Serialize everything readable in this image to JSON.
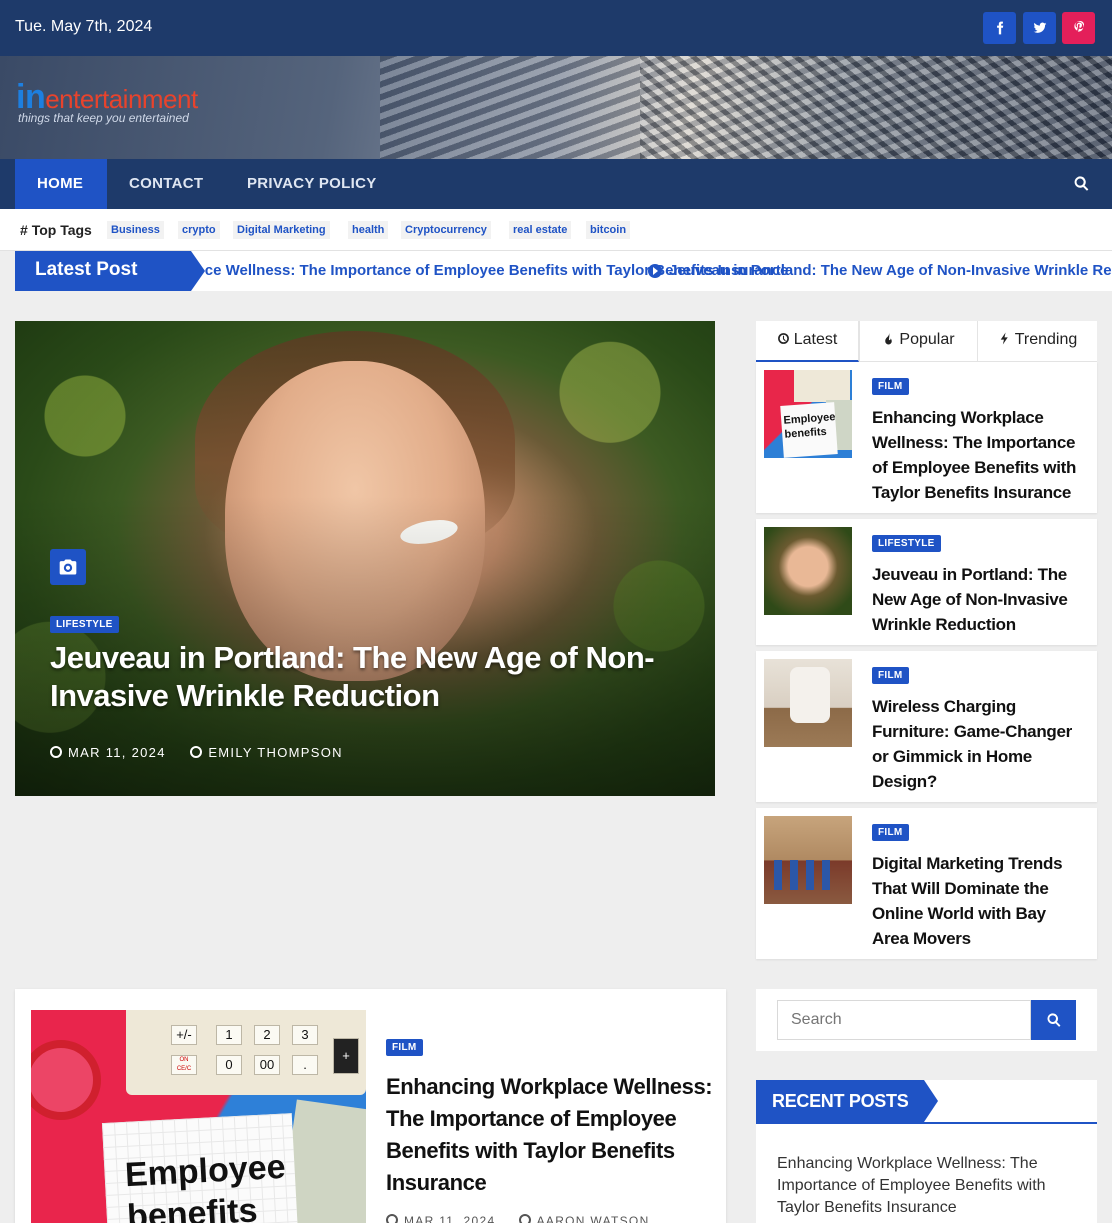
{
  "topbar": {
    "date": "Tue. May 7th, 2024",
    "social": [
      {
        "icon": "facebook-icon",
        "color": "#1f53c5"
      },
      {
        "icon": "twitter-icon",
        "color": "#1f53c5"
      },
      {
        "icon": "pinterest-icon",
        "color": "#e41f5a"
      }
    ]
  },
  "header": {
    "logo_in": "in",
    "logo_rest": "entertainment",
    "tagline": "things that keep you entertained"
  },
  "nav": {
    "items": [
      "HOME",
      "CONTACT",
      "PRIVACY POLICY"
    ],
    "active": "HOME"
  },
  "tags": {
    "label": "Top Tags",
    "items": [
      "Business",
      "crypto",
      "Digital Marketing",
      "health",
      "Cryptocurrency",
      "real estate",
      "bitcoin"
    ]
  },
  "ticker": {
    "label": "Latest Post",
    "items": [
      "Enhancing Workplace Wellness: The Importance of Employee Benefits with Taylor Benefits Insurance",
      "Jeuveau in Portland: The New Age of Non-Invasive Wrinkle Reduction"
    ]
  },
  "hero": {
    "category": "LIFESTYLE",
    "title": "Jeuveau in Portland: The New Age of Non-Invasive Wrinkle Reduction",
    "date": "MAR 11, 2024",
    "author": "EMILY THOMPSON"
  },
  "sidebar_tabs": [
    "Latest",
    "Popular",
    "Trending"
  ],
  "sidebar_posts": [
    {
      "category": "FILM",
      "title": "Enhancing Workplace Wellness: The Importance of Employee Benefits with Taylor Benefits Insurance",
      "thumb_text": "Employee benefits"
    },
    {
      "category": "LIFESTYLE",
      "title": "Jeuveau in Portland: The New Age of Non-Invasive Wrinkle Reduction"
    },
    {
      "category": "FILM",
      "title": "Wireless Charging Furniture: Game-Changer or Gimmick in Home Design?"
    },
    {
      "category": "FILM",
      "title": "Digital Marketing Trends That Will Dominate the Online World with Bay Area Movers"
    }
  ],
  "feature_post": {
    "category": "FILM",
    "title": "Enhancing Workplace Wellness: The Importance of Employee Benefits with Taylor Benefits Insurance",
    "date": "MAR 11, 2024",
    "author": "AARON WATSON",
    "image_text_1": "Employee",
    "image_text_2": "benefits",
    "keys": [
      "+/-",
      "1",
      "2",
      "3",
      "ON CE/C",
      "0",
      "00",
      ".",
      "+"
    ]
  },
  "search": {
    "placeholder": "Search"
  },
  "recent_posts": {
    "label": "RECENT POSTS",
    "items": [
      "Enhancing Workplace Wellness: The Importance of Employee Benefits with Taylor Benefits Insurance"
    ]
  },
  "colors": {
    "primary": "#1f53c5",
    "navy": "#1e3a6a",
    "pinterest": "#e41f5a"
  }
}
